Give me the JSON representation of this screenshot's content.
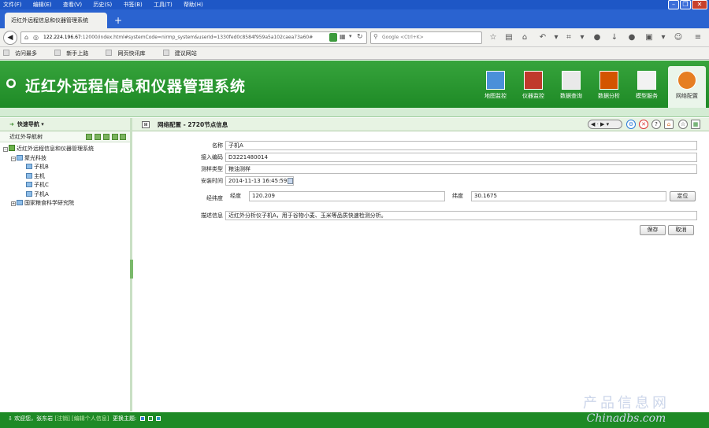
{
  "browser": {
    "menu": [
      "文件(F)",
      "编辑(E)",
      "查看(V)",
      "历史(S)",
      "书签(B)",
      "工具(T)",
      "帮助(H)"
    ],
    "tab_title": "近红外远程信息和仪器管理系统",
    "new_tab": "+",
    "url_host": "122.224.196.67",
    "url_rest": ":12000/index.html#systemCode=nirmp_system&userId=1330fed0c8584f959a5a102caea73a60#",
    "search_placeholder": "Google <Ctrl+K>",
    "bookmarks": [
      "访问最多",
      "新手上路",
      "网页快讯库",
      "建议网站"
    ]
  },
  "app": {
    "title": "近红外远程信息和仪器管理系统",
    "modules": [
      "地图监控",
      "仪器监控",
      "数据查询",
      "数据分析",
      "模型服务",
      "网络配置"
    ],
    "active_module": "网络配置"
  },
  "left": {
    "header": "快速导航",
    "subheader": "近红外导航树",
    "tree": [
      {
        "label": "近红外远程信息和仪器管理系统",
        "level": 0,
        "kind": "root"
      },
      {
        "label": "聚光科技",
        "level": 1,
        "kind": "org"
      },
      {
        "label": "子机B",
        "level": 2,
        "kind": "node"
      },
      {
        "label": "主机",
        "level": 2,
        "kind": "node"
      },
      {
        "label": "子机C",
        "level": 2,
        "kind": "node"
      },
      {
        "label": "子机A",
        "level": 2,
        "kind": "node"
      },
      {
        "label": "国家粮食科学研究院",
        "level": 1,
        "kind": "org"
      }
    ]
  },
  "main": {
    "header": "网络配置 - 2720节点信息",
    "form": {
      "name_label": "名称",
      "name_value": "子机A",
      "code_label": "接入编码",
      "code_value": "D3221480014",
      "type_label": "测样类型",
      "type_value": "粮油测样",
      "time_label": "安装时间",
      "time_value": "2014-11-13 16:45:59",
      "lnglat_label": "经纬度",
      "lng_label": "经度",
      "lng_value": "120.209",
      "lat_label": "纬度",
      "lat_value": "30.1675",
      "locate_button": "定位",
      "desc_label": "描述信息",
      "desc_value": "近红外分析仪子机A，用于谷物小麦、玉米等品质快速检测分析。",
      "save_button": "保存",
      "cancel_button": "取消"
    }
  },
  "footer": {
    "welcome": "欢迎您，张东岩",
    "logout": "[注销]",
    "edit_info": "[编辑个人信息]",
    "theme_label": "更换主题:",
    "theme_colors": [
      "#3a7bd5",
      "#2e9e3a",
      "#2d9bc2"
    ]
  },
  "watermark": {
    "line1": "产品信息网",
    "line2": "Chinadbs.com"
  }
}
